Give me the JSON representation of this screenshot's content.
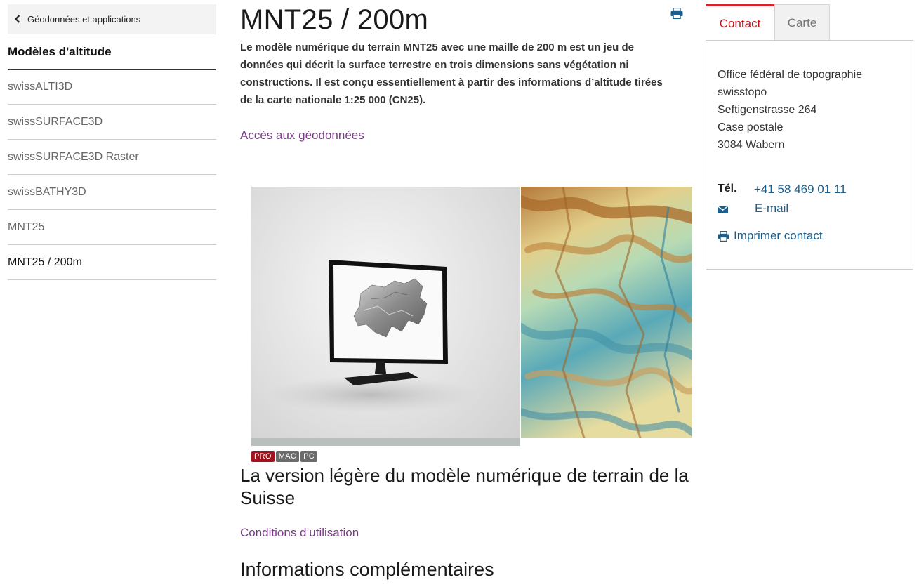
{
  "sidebar": {
    "back_label": "Géodonnées et applications",
    "section_title": "Modèles d'altitude",
    "items": [
      {
        "label": "swissALTI3D"
      },
      {
        "label": "swissSURFACE3D"
      },
      {
        "label": "swissSURFACE3D Raster"
      },
      {
        "label": "swissBATHY3D"
      },
      {
        "label": "MNT25"
      },
      {
        "label": "MNT25 / 200m"
      }
    ]
  },
  "main": {
    "title": "MNT25 / 200m",
    "lead": "Le modèle numérique du terrain MNT25 avec une maille de 200 m est un jeu de données qui décrit la surface terrestre en trois dimensions sans végétation ni constructions. Il est conçu essentiellement à partir des informations d’altitude tirées de la carte nationale 1:25 000 (CN25).",
    "geo_link": "Accès aux géodonnées",
    "badges": [
      "PRO",
      "MAC",
      "PC"
    ],
    "subtitle": "La version légère du modèle numérique de terrain de la Suisse",
    "conditions_link": "Conditions d’utilisation",
    "info_title": "Informations complémentaires"
  },
  "contact": {
    "tabs": [
      "Contact",
      "Carte"
    ],
    "address_lines": [
      "Office fédéral de topographie",
      "swisstopo",
      "Seftigenstrasse 264",
      "Case postale",
      "3084 Wabern"
    ],
    "tel_label": "Tél.",
    "tel_value": "+41 58 469 01 11",
    "email_label": "E-mail",
    "print_label": "Imprimer contact"
  },
  "colors": {
    "accent_red": "#d8232a",
    "link_purple": "#7a3c87",
    "link_blue": "#1c5f8c"
  }
}
